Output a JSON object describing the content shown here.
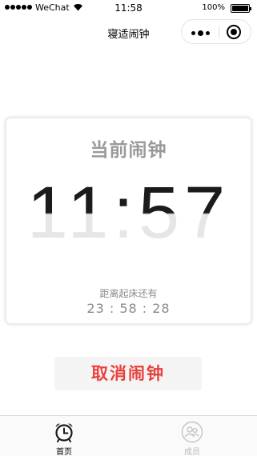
{
  "status_bar": {
    "carrier": "WeChat",
    "time": "11:58",
    "battery": "100%"
  },
  "nav": {
    "title": "寝适闹钟"
  },
  "alarm_card": {
    "title": "当前闹钟",
    "alarm_time": "11:57",
    "countdown_label": "距离起床还有",
    "countdown": "23 : 58 : 28"
  },
  "cancel_button": {
    "label": "取消闹钟",
    "color": "#e8413d"
  },
  "tab_bar": {
    "tabs": [
      {
        "label": "首页",
        "icon": "alarm-clock-icon",
        "active": true
      },
      {
        "label": "成员",
        "icon": "members-icon",
        "active": false
      }
    ]
  }
}
